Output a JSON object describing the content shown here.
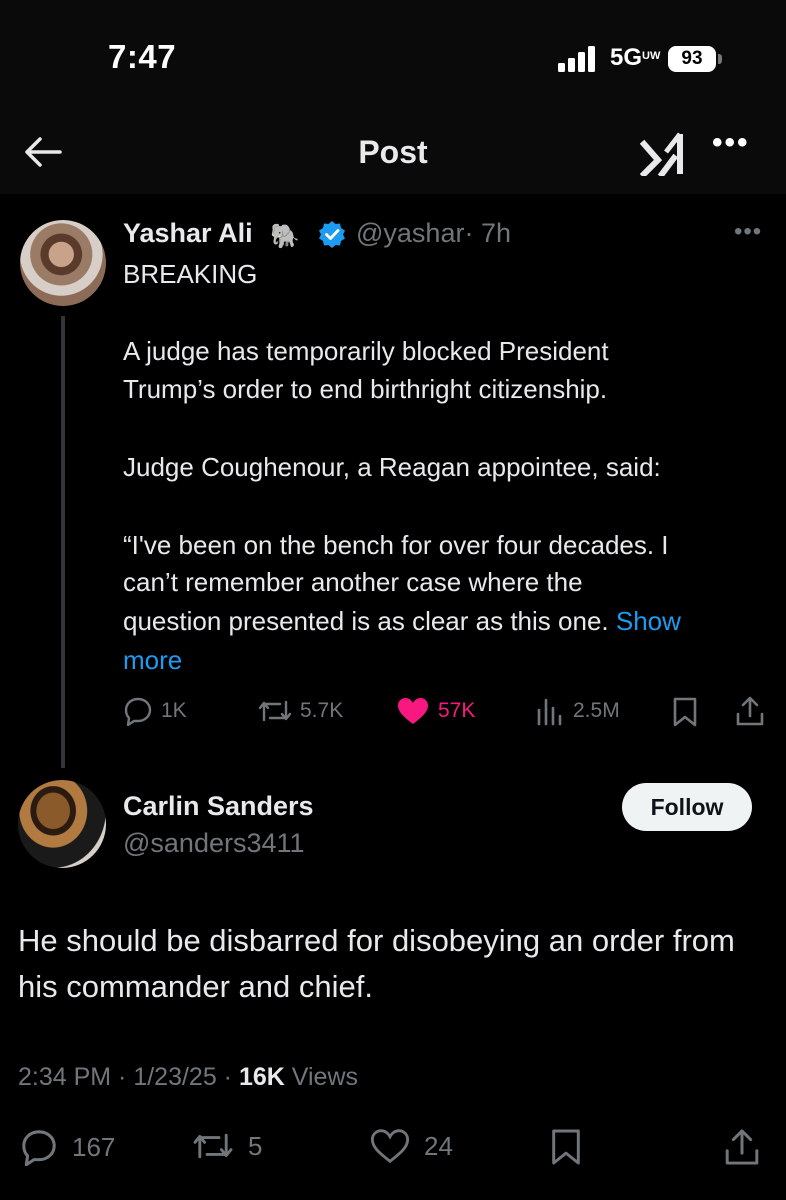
{
  "status_bar": {
    "time": "7:47",
    "network": "5G",
    "network_sub": "UW",
    "battery": "93"
  },
  "nav": {
    "title": "Post"
  },
  "original_post": {
    "name": "Yashar Ali",
    "handle": "@yashar",
    "time": "· 7h",
    "lines": [
      "BREAKING",
      "A judge has temporarily blocked President",
      "Trump’s order to end birthright citizenship.",
      "Judge Coughenour, a Reagan appointee, said:",
      "“I've been on the bench for over four decades. I",
      "can’t remember another case where the",
      "question presented is as clear as this one."
    ],
    "show_more_a": "Show",
    "show_more_b": "more",
    "replies": "1K",
    "reposts": "5.7K",
    "likes": "57K",
    "views": "2.5M",
    "like_color": "#f91880"
  },
  "reply_post": {
    "name": "Carlin Sanders",
    "handle": "@sanders3411",
    "follow_label": "Follow",
    "text": "He should be disbarred for disobeying an order from his commander and chief.",
    "time": "2:34 PM · 1/23/25 · ",
    "views_count": "16K",
    "views_label": " Views",
    "replies": "167",
    "reposts": "5",
    "likes": "24"
  },
  "colors": {
    "accent": "#1d9bf0",
    "muted": "#71767b",
    "background": "#000000"
  }
}
